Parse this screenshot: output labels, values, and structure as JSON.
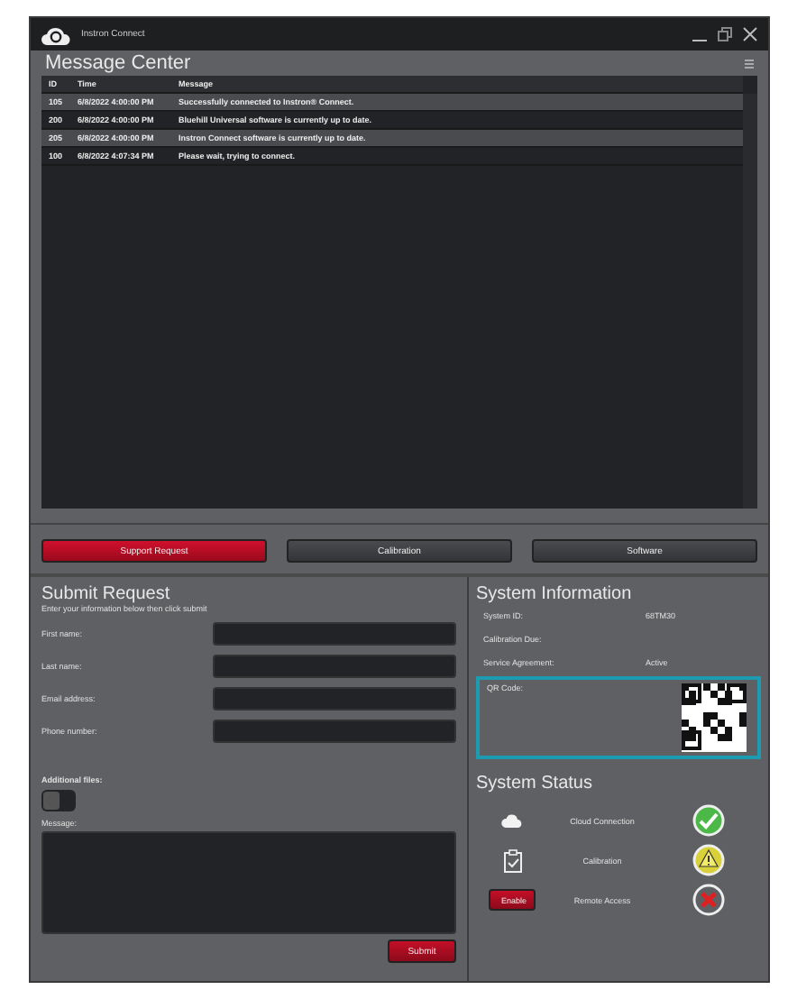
{
  "window": {
    "title": "Instron Connect"
  },
  "message_center": {
    "title": "Message Center",
    "columns": [
      "ID",
      "Time",
      "Message"
    ],
    "rows": [
      {
        "id": "105",
        "time": "6/8/2022 4:00:00 PM",
        "message": "Successfully connected to Instron® Connect."
      },
      {
        "id": "200",
        "time": "6/8/2022 4:00:00 PM",
        "message": "Bluehill Universal software is currently up to date."
      },
      {
        "id": "205",
        "time": "6/8/2022 4:00:00 PM",
        "message": "Instron Connect software is currently up to date."
      },
      {
        "id": "100",
        "time": "6/8/2022 4:07:34 PM",
        "message": "Please wait, trying to connect."
      }
    ]
  },
  "tabs": [
    {
      "label": "Support Request",
      "selected": true
    },
    {
      "label": "Calibration",
      "selected": false
    },
    {
      "label": "Software",
      "selected": false
    }
  ],
  "submit_request": {
    "title": "Submit Request",
    "subtitle": "Enter your information below then click submit",
    "fields": [
      {
        "label": "First name:"
      },
      {
        "label": "Last name:"
      },
      {
        "label": "Email address:"
      },
      {
        "label": "Phone number:"
      }
    ],
    "additional_files": {
      "label": "Additional files:",
      "on": false
    },
    "message_label": "Message:",
    "submit": "Submit"
  },
  "system_information": {
    "title": "System Information",
    "rows": [
      {
        "label": "System ID:",
        "value": "68TM30"
      },
      {
        "label": "Calibration Due:"
      },
      {
        "label": "Service Agreement:",
        "value": "Active"
      }
    ],
    "qr_label": "QR Code:"
  },
  "system_status": {
    "title": "System Status",
    "items": [
      {
        "kind": "cloud",
        "label": "Cloud Connection",
        "indicator": {
          "kind": "ok"
        }
      },
      {
        "kind": "clipboard",
        "label": "Calibration",
        "indicator": {
          "kind": "warning"
        }
      },
      {
        "kind": "button",
        "button": "Enable",
        "label": "Remote Access",
        "indicator": {
          "kind": "error"
        }
      }
    ]
  }
}
